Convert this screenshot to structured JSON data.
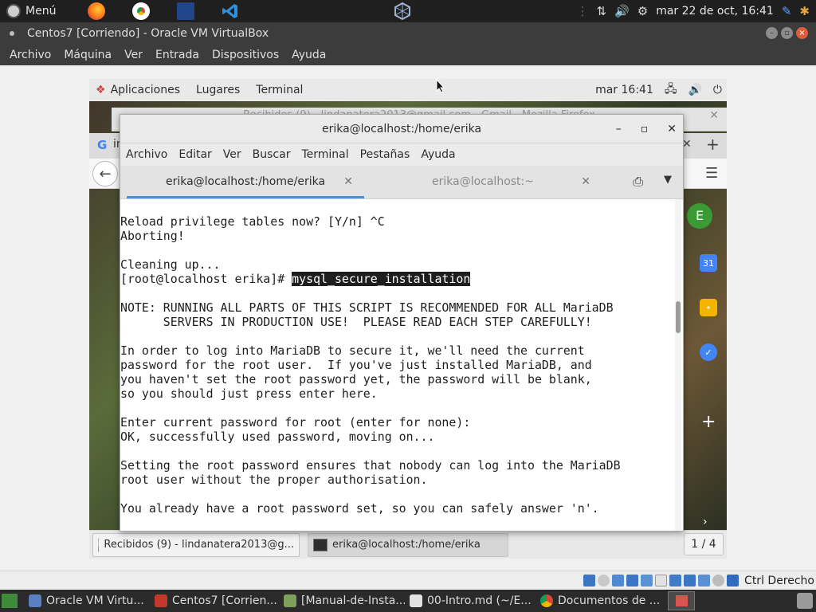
{
  "host_panel": {
    "menu_label": "Menú",
    "datetime": "mar 22 de oct, 16:41"
  },
  "vbox": {
    "title": "Centos7 [Corriendo] - Oracle VM VirtualBox",
    "menu": [
      "Archivo",
      "Máquina",
      "Ver",
      "Entrada",
      "Dispositivos",
      "Ayuda"
    ],
    "host_key": "Ctrl Derecho"
  },
  "guest": {
    "panel": {
      "applications": "Aplicaciones",
      "places": "Lugares",
      "terminal": "Terminal",
      "clock": "mar 16:41"
    },
    "firefox_behind_title": "Recibidos (9) - lindanatera2013@gmail.com - Gmail - Mozilla Firefox",
    "firefox_tab_fragment": "in",
    "gmail_avatar_letter": "E",
    "calendar_day": "31",
    "taskbar": {
      "items": [
        {
          "label": "Recibidos (9) - lindanatera2013@g..."
        },
        {
          "label": "erika@localhost:/home/erika"
        }
      ],
      "workspace": "1 / 4"
    }
  },
  "terminal": {
    "title": "erika@localhost:/home/erika",
    "menu": [
      "Archivo",
      "Editar",
      "Ver",
      "Buscar",
      "Terminal",
      "Pestañas",
      "Ayuda"
    ],
    "tabs": [
      {
        "label": "erika@localhost:/home/erika",
        "active": true
      },
      {
        "label": "erika@localhost:~",
        "active": false
      }
    ],
    "lines": [
      "Reload privilege tables now? [Y/n] ^C",
      "Aborting!",
      "",
      "Cleaning up...",
      "",
      "",
      "NOTE: RUNNING ALL PARTS OF THIS SCRIPT IS RECOMMENDED FOR ALL MariaDB",
      "      SERVERS IN PRODUCTION USE!  PLEASE READ EACH STEP CAREFULLY!",
      "",
      "In order to log into MariaDB to secure it, we'll need the current",
      "password for the root user.  If you've just installed MariaDB, and",
      "you haven't set the root password yet, the password will be blank,",
      "so you should just press enter here.",
      "",
      "Enter current password for root (enter for none):",
      "OK, successfully used password, moving on...",
      "",
      "Setting the root password ensures that nobody can log into the MariaDB",
      "root user without the proper authorisation.",
      "",
      "You already have a root password set, so you can safely answer 'n'."
    ],
    "prompt": "[root@localhost erika]# ",
    "command": "mysql_secure_installation"
  },
  "host_taskbar": {
    "items": [
      {
        "label": "Oracle VM Virtu..."
      },
      {
        "label": "Centos7 [Corrien..."
      },
      {
        "label": "[Manual-de-Insta..."
      },
      {
        "label": "00-Intro.md (~/E..."
      },
      {
        "label": "Documentos de ..."
      }
    ]
  },
  "colors": {
    "accent_tab": "#4a90d9",
    "vbox_chrome": "#3c3c3c",
    "close_button": "#e05b3a"
  }
}
